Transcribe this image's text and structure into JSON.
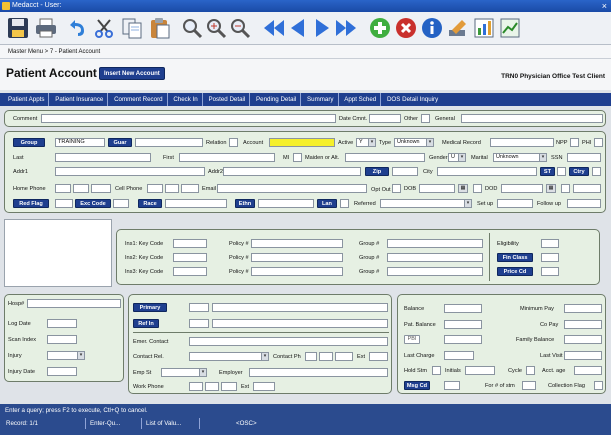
{
  "window": {
    "title": "Medacct - User:",
    "close": "×"
  },
  "breadcrumb": "Master Menu > 7 - Patient Account",
  "header": {
    "title": "Patient Account",
    "insert_button": "Insert New Account",
    "clinic": "TRN0  Physician Office Test Client"
  },
  "nav_tabs": [
    "Patient Appts",
    "Patient Insurance",
    "Comment Record",
    "Check In",
    "Posted Detail",
    "Pending Detail",
    "Summary",
    "Appt Sched",
    "DOS Detail Inquiry"
  ],
  "comment_row": {
    "comment": "Comment",
    "date_cmnt": "Date Cmnt.",
    "other": "Other",
    "general": "General"
  },
  "demo": {
    "group_btn": "Group",
    "group_value": "TRAINING",
    "guar_btn": "Guar",
    "relation": "Relation",
    "account": "Account",
    "active": "Active",
    "active_value": "Y",
    "type": "Type",
    "type_value": "Unknown",
    "medical_record": "Medical Record",
    "npp": "NPP",
    "phi": "PHI",
    "last": "Last",
    "first": "First",
    "mi": "MI",
    "maiden": "Maiden or Alt.",
    "gender": "Gender",
    "gender_value": "U",
    "marital": "Marital",
    "marital_value": "Unknown",
    "ssn": "SSN",
    "addr1": "Addr1",
    "addr2": "Addr2",
    "zip_btn": "Zip",
    "city": "City",
    "st_btn": "ST",
    "ctry_btn": "Ctry",
    "home_phone": "Home Phone",
    "cell_phone": "Cell Phone",
    "email": "Email",
    "opt_out": "Opt Out",
    "dob": "DOB",
    "dod": "DOD",
    "red_flag_btn": "Red Flag",
    "exc_code_btn": "Exc Code",
    "race_btn": "Race",
    "ethn_btn": "Ethn",
    "lan_btn": "Lan",
    "referred": "Referred",
    "set_up": "Set up",
    "follow_up": "Follow up"
  },
  "insurance": {
    "rows": [
      {
        "key": "Ins1: Key Code",
        "policy": "Policy #",
        "group": "Group #"
      },
      {
        "key": "Ins2: Key Code",
        "policy": "Policy #",
        "group": "Group #"
      },
      {
        "key": "Ins3: Key Code",
        "policy": "Policy #",
        "group": "Group #"
      }
    ],
    "eligibility": "Eligibility",
    "fin_class_btn": "Fin Class",
    "price_cd_btn": "Price Cd"
  },
  "hosp": {
    "hosp": "Hosp#",
    "log_date": "Log Date",
    "scan_index": "Scan Index",
    "injury": "Injury",
    "injury_date": "Injury Date"
  },
  "contact": {
    "primary_btn": "Primary",
    "ref_in_btn": "Ref In",
    "emer_contact": "Emer. Contact",
    "contact_rel": "Contact Rel.",
    "contact_ph": "Contact Ph",
    "ext": "Ext",
    "emp_st": "Emp St",
    "employer": "Employer",
    "work_phone": "Work Phone",
    "ext2": "Ext"
  },
  "balance": {
    "balance": "Balance",
    "minimum_pay": "Minimum Pay",
    "pat_balance": "Pat. Balance",
    "co_pay": "Co Pay",
    "pbi_btn": "PBI",
    "family_balance": "Family Balance",
    "last_charge": "Last Charge",
    "last_visit": "Last Visit",
    "hold_stm": "Hold Stm",
    "initials": "Initials",
    "cycle": "Cycle",
    "acct_age": "Acct. age",
    "msg_cd_btn": "Msg Cd",
    "for_stm": "For # of stm",
    "collection_flag": "Collection Flag"
  },
  "status": {
    "message": "Enter a query;  press F2 to execute, Ctl+Q to cancel.",
    "record": "Record: 1/1",
    "mode": "Enter-Qu...",
    "lov": "List of Valu...",
    "osc": "<OSC>"
  },
  "icons": [
    "save-icon",
    "print-icon",
    "undo-icon",
    "cut-icon",
    "copy-icon",
    "paste-icon",
    "search-icon",
    "search-plus-icon",
    "search-minus-icon",
    "first-record-icon",
    "prev-record-icon",
    "next-record-icon",
    "last-record-icon",
    "add-icon",
    "delete-icon",
    "info-icon",
    "edit-icon",
    "chart-icon",
    "report-icon"
  ]
}
